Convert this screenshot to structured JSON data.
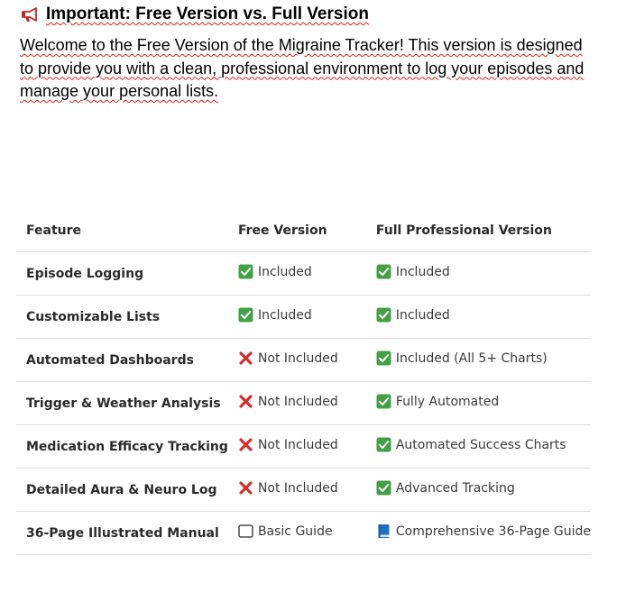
{
  "heading": {
    "icon": "megaphone-icon",
    "text": "Important: Free Version vs. Full Version"
  },
  "intro": {
    "text": "Welcome to the Free Version of the Migraine Tracker! This version is designed to provide you with a clean, professional environment to log your episodes and manage your personal lists."
  },
  "table": {
    "headers": [
      "Feature",
      "Free Version",
      "Full Professional Version"
    ],
    "rows": [
      {
        "feature": "Episode Logging",
        "free": {
          "icon": "check-mark-button-icon",
          "text": "Included"
        },
        "full": {
          "icon": "check-mark-button-icon",
          "text": "Included"
        }
      },
      {
        "feature": "Customizable Lists",
        "free": {
          "icon": "check-mark-button-icon",
          "text": "Included"
        },
        "full": {
          "icon": "check-mark-button-icon",
          "text": "Included"
        }
      },
      {
        "feature": "Automated Dashboards",
        "free": {
          "icon": "cross-mark-icon",
          "text": "Not Included"
        },
        "full": {
          "icon": "check-mark-button-icon",
          "text": "Included (All 5+ Charts)"
        }
      },
      {
        "feature": "Trigger & Weather Analysis",
        "free": {
          "icon": "cross-mark-icon",
          "text": "Not Included"
        },
        "full": {
          "icon": "check-mark-button-icon",
          "text": "Fully Automated"
        }
      },
      {
        "feature": "Medication Efficacy Tracking",
        "free": {
          "icon": "cross-mark-icon",
          "text": "Not Included"
        },
        "full": {
          "icon": "check-mark-button-icon",
          "text": "Automated Success Charts"
        }
      },
      {
        "feature": "Detailed Aura & Neuro Log",
        "free": {
          "icon": "cross-mark-icon",
          "text": "Not Included"
        },
        "full": {
          "icon": "check-mark-button-icon",
          "text": "Advanced Tracking"
        }
      },
      {
        "feature": "36-Page Illustrated Manual",
        "free": {
          "icon": "white-square-icon",
          "text": "Basic Guide"
        },
        "full": {
          "icon": "blue-book-icon",
          "text": "Comprehensive 36-Page Guide"
        }
      }
    ]
  },
  "colors": {
    "check_green": "#43a047",
    "cross_red": "#d32f2f",
    "book_blue": "#1e6fc4",
    "divider": "#dddddd",
    "spellcheck_underline": "#e02020"
  }
}
